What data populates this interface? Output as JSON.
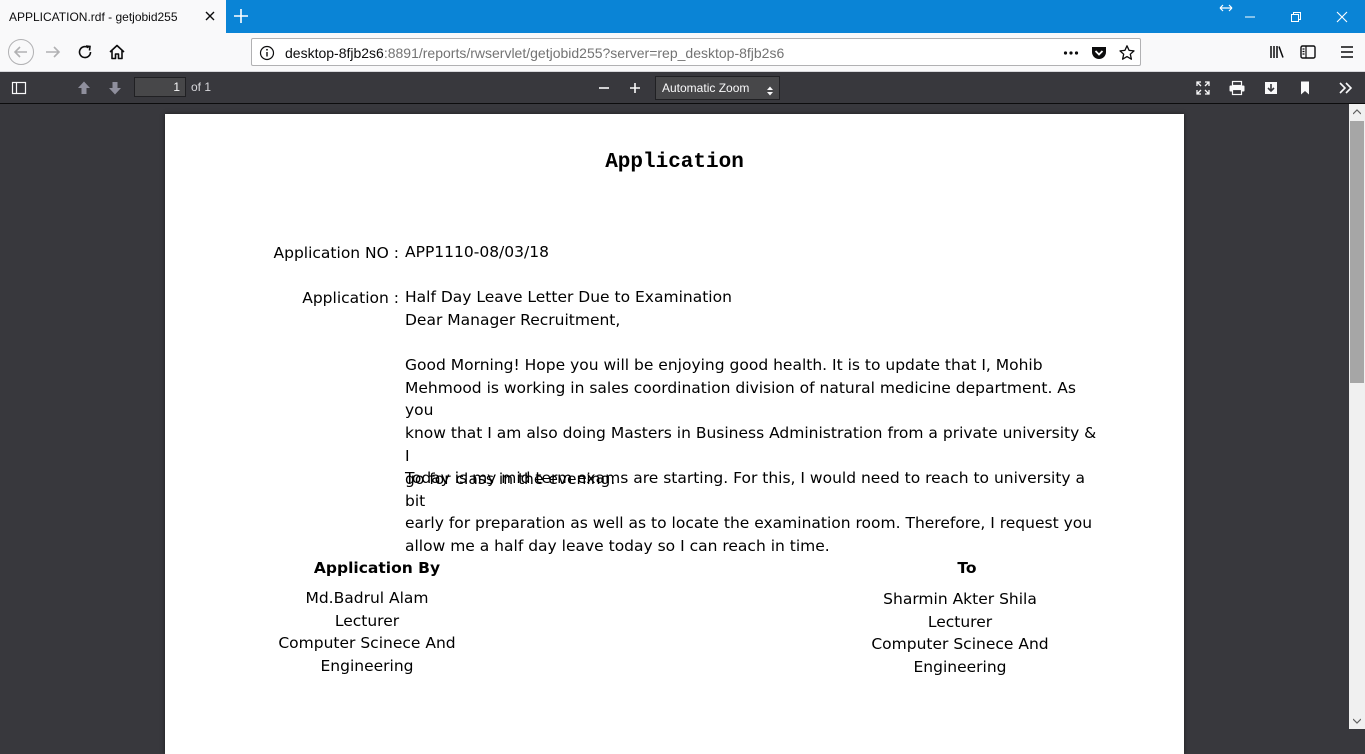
{
  "browser": {
    "tab_title": "APPLICATION.rdf - getjobid255",
    "url_host": "desktop-8fjb2s6",
    "url_rest": ":8891/reports/rwservlet/getjobid255?server=rep_desktop-8fjb2s6",
    "accent_color": "#0a84d6"
  },
  "pdf_toolbar": {
    "page_number": "1",
    "page_of": "of 1",
    "zoom": "Automatic Zoom"
  },
  "document": {
    "title": "Application",
    "app_no_label": "Application NO :",
    "app_no_value": "APP1110-08/03/18",
    "application_label": "Application :",
    "subject": "Half Day Leave Letter Due to Examination",
    "salutation": "Dear Manager Recruitment,",
    "paragraph1": [
      "Good Morning! Hope you will be enjoying good health. It is to update that I, Mohib",
      "Mehmood is working in sales coordination division of natural medicine department. As you",
      "know that I am also doing Masters in Business Administration from a private university & I",
      "go for class in the evening."
    ],
    "paragraph2": [
      "Today is my mid term exams are starting. For this, I would need to reach to university a bit",
      "early for preparation as well as to locate the examination room. Therefore, I request you",
      "allow me a half day leave today so I can reach in time."
    ],
    "from": {
      "heading": "Application By",
      "name": "Md.Badrul Alam",
      "title": "Lecturer",
      "dept1": "Computer Scinece And",
      "dept2": "Engineering"
    },
    "to": {
      "heading": "To",
      "name": "Sharmin Akter Shila",
      "title": "Lecturer",
      "dept1": "Computer Scinece And",
      "dept2": "Engineering"
    }
  }
}
